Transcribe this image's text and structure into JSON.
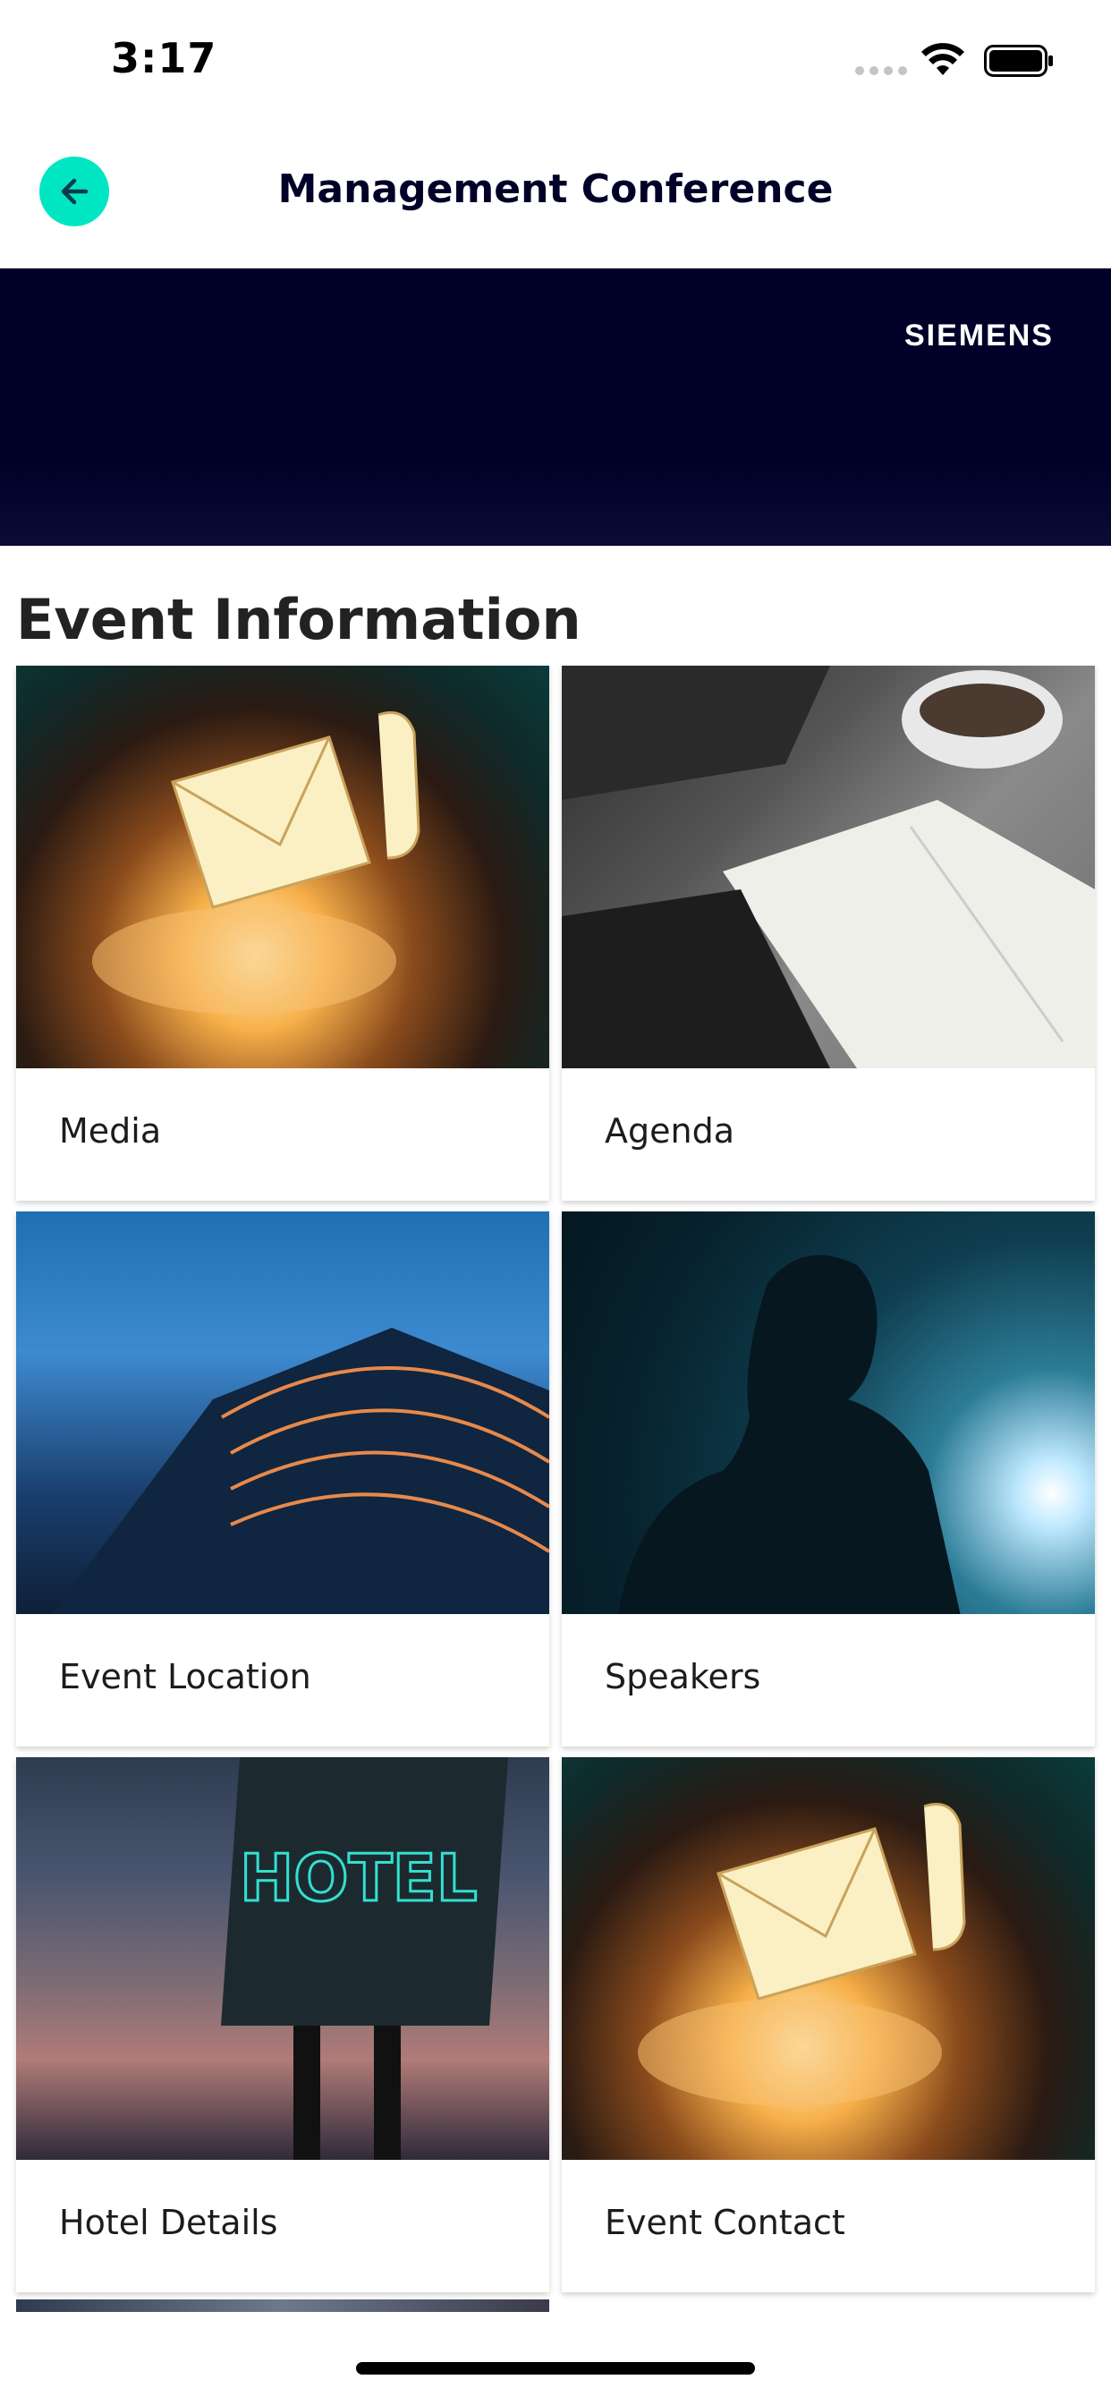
{
  "status_bar": {
    "time": "3:17"
  },
  "nav": {
    "title": "Management Conference",
    "back_label": ""
  },
  "banner": {
    "logo_text": "SIEMENS",
    "background": "#000028"
  },
  "section": {
    "title": "Event Information"
  },
  "tiles": [
    {
      "label": "Media",
      "image": "envelope-phone-hands-image"
    },
    {
      "label": "Agenda",
      "image": "notebook-coffee-image"
    },
    {
      "label": "Event Location",
      "image": "conference-building-image"
    },
    {
      "label": "Speakers",
      "image": "silhouette-speaker-image"
    },
    {
      "label": "Hotel Details",
      "image": "hotel-sign-image"
    },
    {
      "label": "Event Contact",
      "image": "envelope-phone-hands-image"
    }
  ],
  "colors": {
    "accent": "#00e6c3",
    "brand_dark": "#000028"
  }
}
